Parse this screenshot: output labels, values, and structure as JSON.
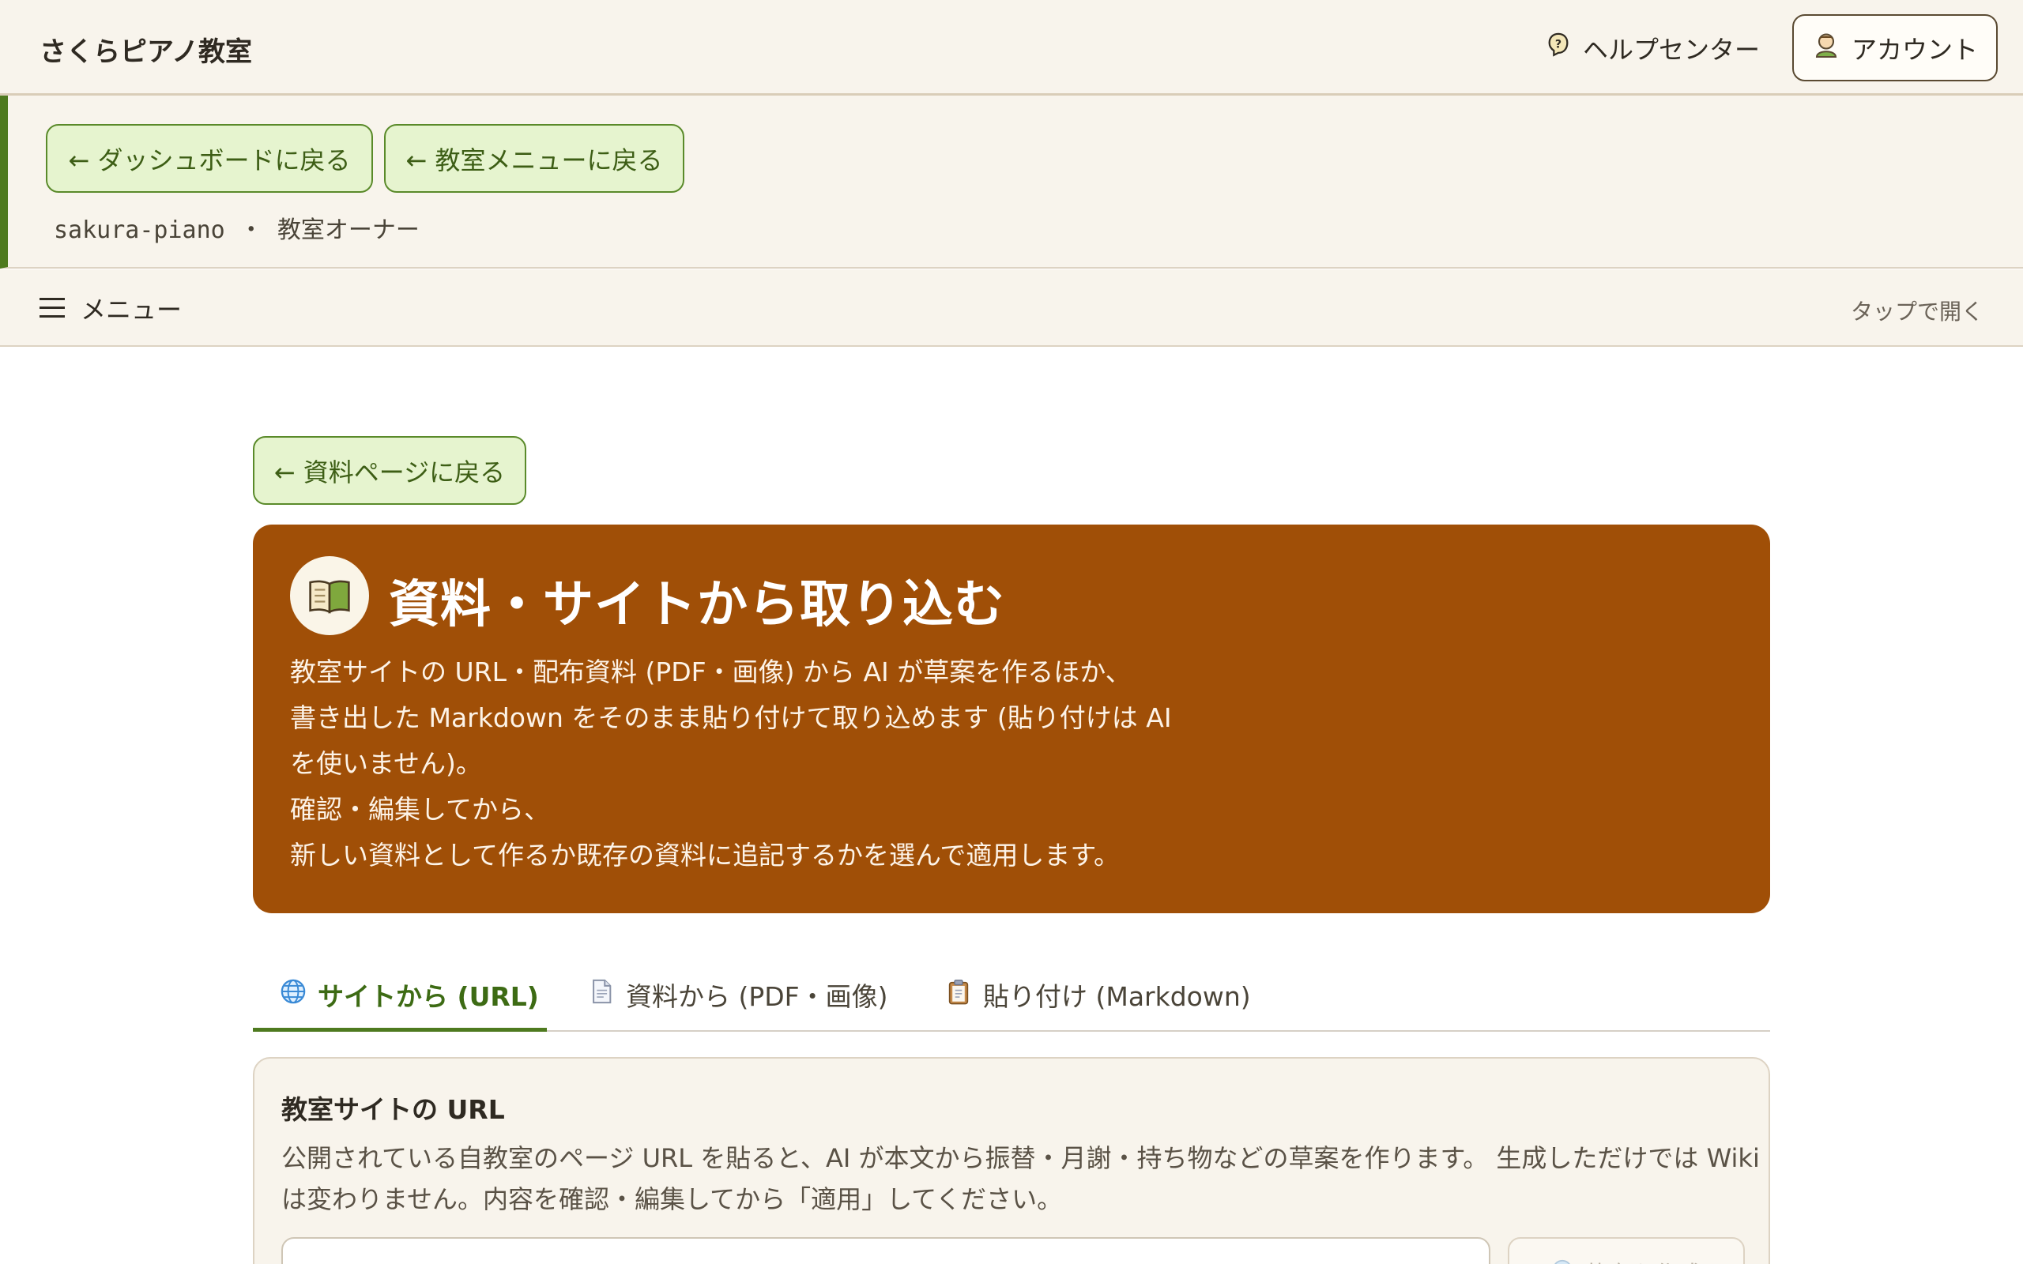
{
  "header": {
    "brand": "さくらピアノ教室",
    "help_label": "ヘルプセンター",
    "account_label": "アカウント"
  },
  "owner_bar": {
    "back_dashboard": "← ダッシュボードに戻る",
    "back_classroom_menu": "← 教室メニューに戻る",
    "meta": "sakura-piano ・ 教室オーナー"
  },
  "menu_bar": {
    "label": "メニュー",
    "hint": "タップで開く"
  },
  "main": {
    "back_button": "← 資料ページに戻る",
    "hero": {
      "title": "資料・サイトから取り込む",
      "description_lines": [
        "教室サイトの URL・配布資料 (PDF・画像) から AI が草案を作るほか、",
        "書き出した Markdown をそのまま貼り付けて取り込めます (貼り付けは AI",
        "を使いません)。",
        "確認・編集してから、",
        "新しい資料として作るか既存の資料に追記するかを選んで適用します。"
      ]
    },
    "tabs": [
      {
        "label": "サイトから (URL)",
        "icon": "globe-icon",
        "active": true
      },
      {
        "label": "資料から (PDF・画像)",
        "icon": "document-icon",
        "active": false
      },
      {
        "label": "貼り付け (Markdown)",
        "icon": "clipboard-icon",
        "active": false
      }
    ],
    "url_card": {
      "title": "教室サイトの URL",
      "description_line1": "公開されている自教室のページ URL を貼ると、AI が本文から振替・月謝・持ち物などの草案を作ります。 生成しただけでは Wiki",
      "description_line2": "は変わりません。内容を確認・編集してから「適用」してください。",
      "input_value": "",
      "generate_button": "草案を作成"
    }
  },
  "colors": {
    "accent_green": "#4e7a1f",
    "hero_brown": "#a04f07",
    "cream_bg": "#f8f4ec",
    "pill_green_bg": "#e6f4cf"
  }
}
